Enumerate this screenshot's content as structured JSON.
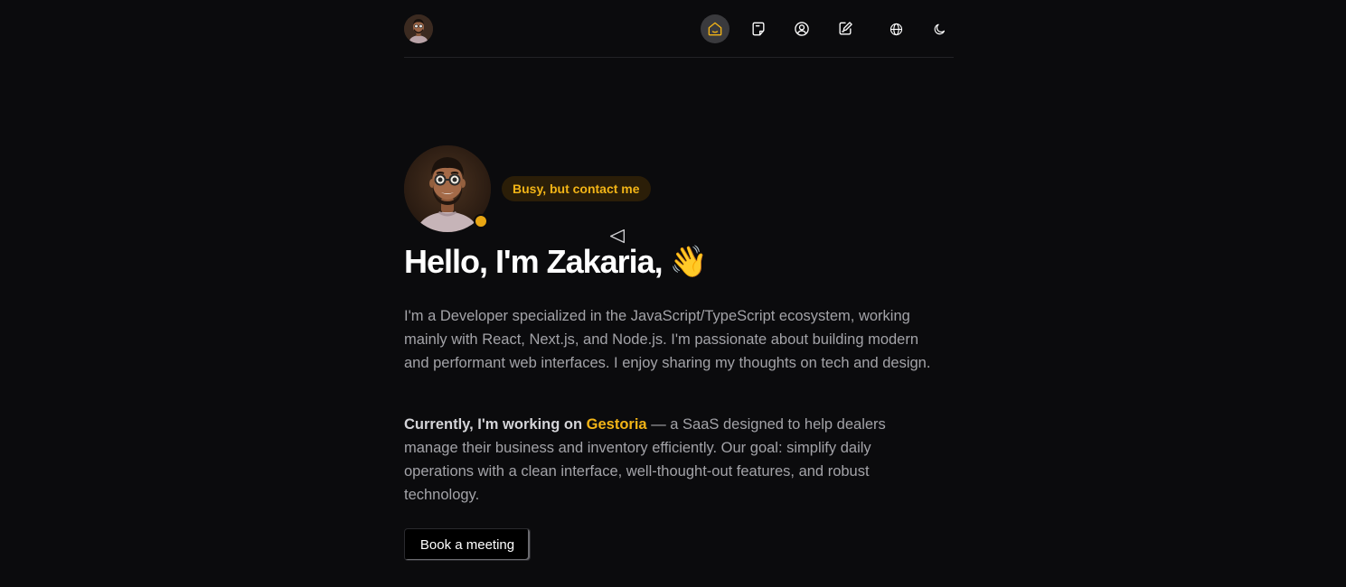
{
  "nav": {
    "items": [
      {
        "icon": "home-icon",
        "active": true
      },
      {
        "icon": "notes-icon",
        "active": false
      },
      {
        "icon": "user-circle-icon",
        "active": false
      },
      {
        "icon": "edit-icon",
        "active": false
      },
      {
        "icon": "globe-icon",
        "active": false
      },
      {
        "icon": "moon-icon",
        "active": false
      }
    ],
    "accent_color": "#f2b417"
  },
  "hero": {
    "status": "Busy, but contact me",
    "status_color": "#e8a613",
    "headline": "Hello, I'm Zakaria,",
    "wave_emoji": "👋",
    "intro": "I'm a Developer specialized in the JavaScript/TypeScript ecosystem, working mainly with React, Next.js, and Node.js. I'm passionate about building modern and performant web interfaces. I enjoy sharing my thoughts on tech and design.",
    "current_prefix": "Currently, I'm working on",
    "current_project": "Gestoria",
    "current_suffix": "— a SaaS designed to help dealers manage their business and inventory efficiently. Our goal: simplify daily operations with a clean interface, well-thought-out features, and robust technology.",
    "cta_label": "Book a meeting"
  }
}
